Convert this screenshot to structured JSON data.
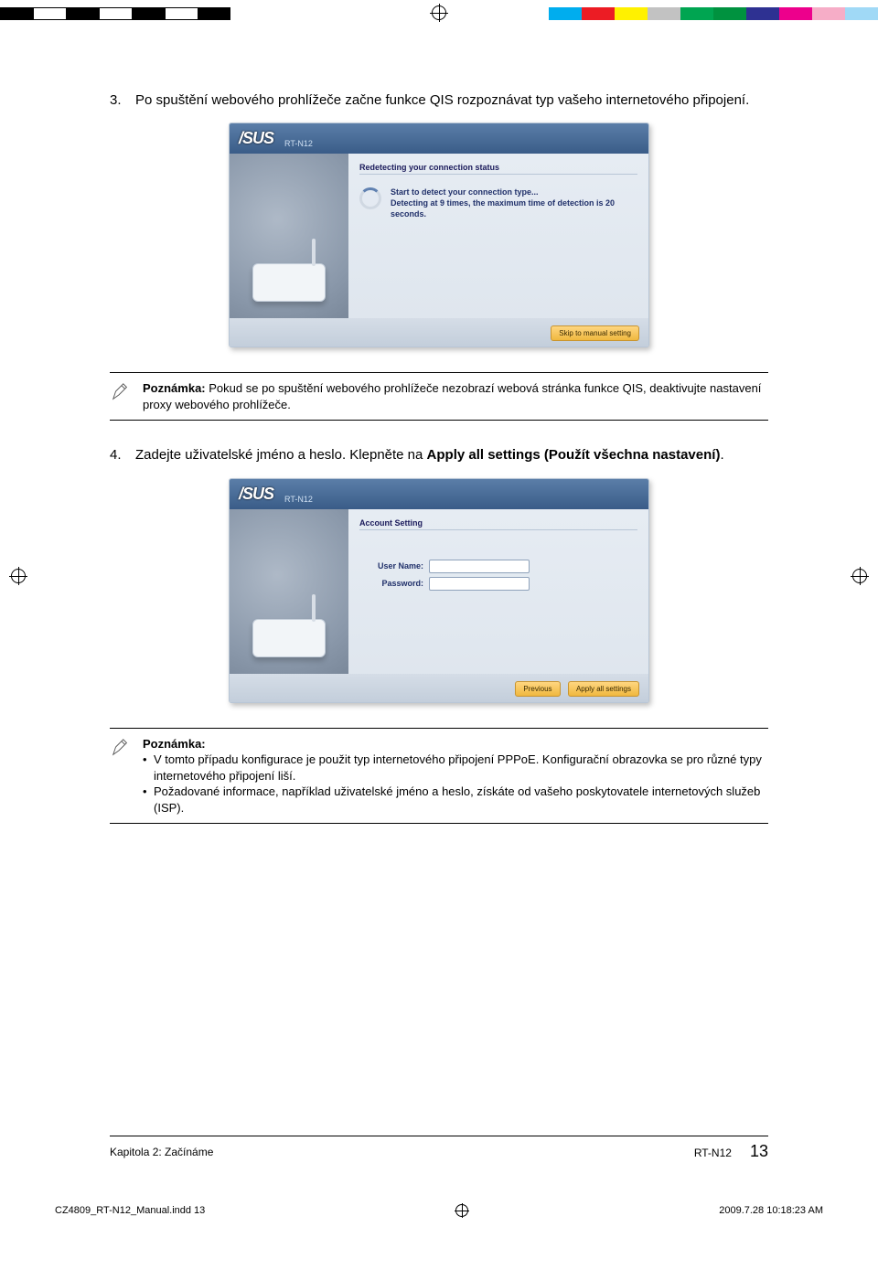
{
  "colorbar": {
    "left": [
      "#000",
      "#fff",
      "#000",
      "#fff",
      "#000",
      "#fff",
      "#000"
    ],
    "right": [
      "#00adee",
      "#ec1c24",
      "#fff100",
      "#c2c2c2",
      "#00a551",
      "#00923f",
      "#2e3192",
      "#ed008c",
      "#f6adc7",
      "#a0d9f6"
    ]
  },
  "step3": {
    "num": "3.",
    "text": "Po spuštění webového prohlížeče začne funkce QIS rozpoznávat typ vašeho internetového připojení."
  },
  "shot1": {
    "brand": "/SUS",
    "model": "RT-N12",
    "section": "Redetecting your connection status",
    "line1": "Start to detect your connection type...",
    "line2": "Detecting at 9 times, the maximum time of detection is 20 seconds.",
    "button": "Skip to manual setting"
  },
  "note1": {
    "label": "Poznámka:",
    "text": "Pokud se po spuštění webového prohlížeče nezobrazí webová stránka funkce QIS, deaktivujte nastavení proxy webového prohlížeče."
  },
  "step4": {
    "num": "4.",
    "text_a": "Zadejte uživatelské jméno a heslo. Klepněte na ",
    "bold": "Apply all settings (Použít všechna nastavení)",
    "text_b": "."
  },
  "shot2": {
    "brand": "/SUS",
    "model": "RT-N12",
    "section": "Account Setting",
    "user_label": "User Name:",
    "pass_label": "Password:",
    "btn_prev": "Previous",
    "btn_apply": "Apply all settings"
  },
  "note2": {
    "label": "Poznámka:",
    "li1": "V tomto případu konfigurace je použit typ internetového připojení PPPoE. Konfigurační obrazovka se pro různé typy internetového připojení liší.",
    "li2": "Požadované informace, například uživatelské jméno a heslo, získáte od vašeho poskytovatele internetových služeb (ISP)."
  },
  "footer": {
    "left": "Kapitola 2: Začínáme",
    "center": "RT-N12",
    "page": "13"
  },
  "indd": {
    "file": "CZ4809_RT-N12_Manual.indd   13",
    "ts": "2009.7.28   10:18:23 AM"
  }
}
